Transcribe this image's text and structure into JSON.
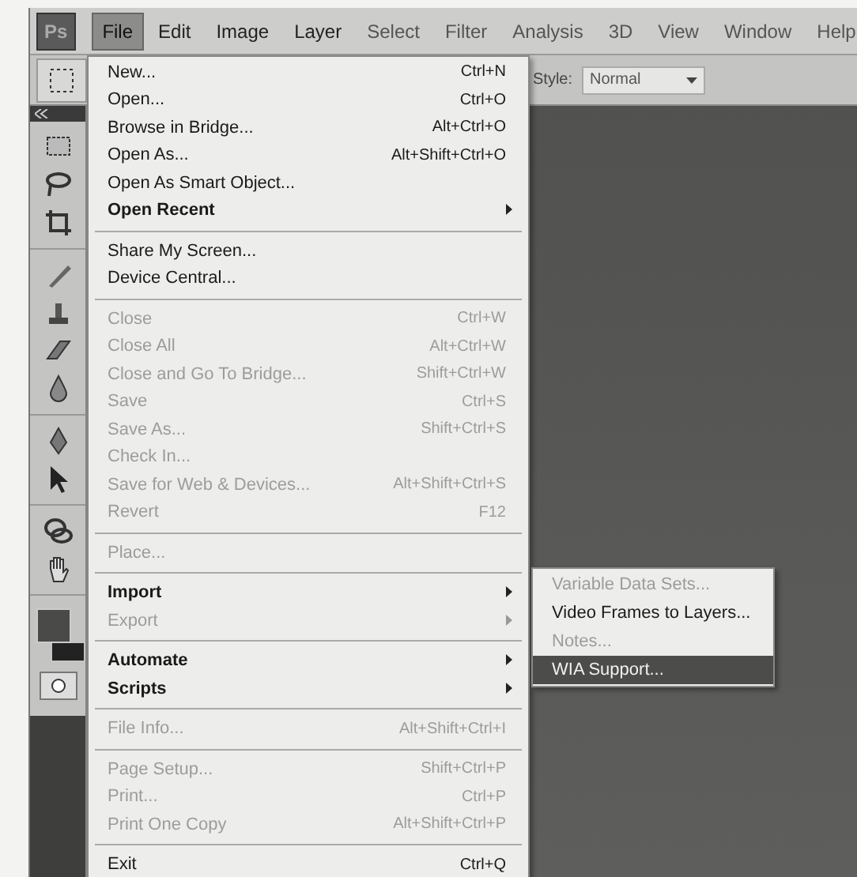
{
  "menubar": {
    "logo": "Ps",
    "items": [
      {
        "label": "File",
        "selected": true
      },
      {
        "label": "Edit",
        "selected": false
      },
      {
        "label": "Image",
        "selected": false
      },
      {
        "label": "Layer",
        "selected": false
      },
      {
        "label": "Select",
        "selected": false
      },
      {
        "label": "Filter",
        "selected": false
      },
      {
        "label": "Analysis",
        "selected": false
      },
      {
        "label": "3D",
        "selected": false
      },
      {
        "label": "View",
        "selected": false
      },
      {
        "label": "Window",
        "selected": false
      },
      {
        "label": "Help",
        "selected": false
      }
    ]
  },
  "options_bar": {
    "style_label": "Style:",
    "style_value": "Normal"
  },
  "file_menu": [
    {
      "kind": "item",
      "label": "New...",
      "shortcut": "Ctrl+N",
      "disabled": false,
      "submenu": false
    },
    {
      "kind": "item",
      "label": "Open...",
      "shortcut": "Ctrl+O",
      "disabled": false,
      "submenu": false
    },
    {
      "kind": "item",
      "label": "Browse in Bridge...",
      "shortcut": "Alt+Ctrl+O",
      "disabled": false,
      "submenu": false
    },
    {
      "kind": "item",
      "label": "Open As...",
      "shortcut": "Alt+Shift+Ctrl+O",
      "disabled": false,
      "submenu": false
    },
    {
      "kind": "item",
      "label": "Open As Smart Object...",
      "disabled": false,
      "submenu": false
    },
    {
      "kind": "item",
      "label": "Open Recent",
      "disabled": false,
      "submenu": true
    },
    {
      "kind": "separator"
    },
    {
      "kind": "item",
      "label": "Share My Screen...",
      "disabled": false,
      "submenu": false
    },
    {
      "kind": "item",
      "label": "Device Central...",
      "disabled": false,
      "submenu": false
    },
    {
      "kind": "separator"
    },
    {
      "kind": "item",
      "label": "Close",
      "shortcut": "Ctrl+W",
      "disabled": true,
      "submenu": false
    },
    {
      "kind": "item",
      "label": "Close All",
      "shortcut": "Alt+Ctrl+W",
      "disabled": true,
      "submenu": false
    },
    {
      "kind": "item",
      "label": "Close and Go To Bridge...",
      "shortcut": "Shift+Ctrl+W",
      "disabled": true,
      "submenu": false
    },
    {
      "kind": "item",
      "label": "Save",
      "shortcut": "Ctrl+S",
      "disabled": true,
      "submenu": false
    },
    {
      "kind": "item",
      "label": "Save As...",
      "shortcut": "Shift+Ctrl+S",
      "disabled": true,
      "submenu": false
    },
    {
      "kind": "item",
      "label": "Check In...",
      "disabled": true,
      "submenu": false
    },
    {
      "kind": "item",
      "label": "Save for Web & Devices...",
      "shortcut": "Alt+Shift+Ctrl+S",
      "disabled": true,
      "submenu": false
    },
    {
      "kind": "item",
      "label": "Revert",
      "shortcut": "F12",
      "disabled": true,
      "submenu": false
    },
    {
      "kind": "separator"
    },
    {
      "kind": "item",
      "label": "Place...",
      "disabled": true,
      "submenu": false
    },
    {
      "kind": "separator"
    },
    {
      "kind": "item",
      "label": "Import",
      "disabled": false,
      "submenu": true
    },
    {
      "kind": "item",
      "label": "Export",
      "disabled": true,
      "submenu": true
    },
    {
      "kind": "separator"
    },
    {
      "kind": "item",
      "label": "Automate",
      "disabled": false,
      "submenu": true
    },
    {
      "kind": "item",
      "label": "Scripts",
      "disabled": false,
      "submenu": true
    },
    {
      "kind": "separator"
    },
    {
      "kind": "item",
      "label": "File Info...",
      "shortcut": "Alt+Shift+Ctrl+I",
      "disabled": true,
      "submenu": false
    },
    {
      "kind": "separator"
    },
    {
      "kind": "item",
      "label": "Page Setup...",
      "shortcut": "Shift+Ctrl+P",
      "disabled": true,
      "submenu": false
    },
    {
      "kind": "item",
      "label": "Print...",
      "shortcut": "Ctrl+P",
      "disabled": true,
      "submenu": false
    },
    {
      "kind": "item",
      "label": "Print One Copy",
      "shortcut": "Alt+Shift+Ctrl+P",
      "disabled": true,
      "submenu": false
    },
    {
      "kind": "separator"
    },
    {
      "kind": "item",
      "label": "Exit",
      "shortcut": "Ctrl+Q",
      "disabled": false,
      "submenu": false
    }
  ],
  "import_submenu": [
    {
      "label": "Variable Data Sets...",
      "disabled": true,
      "selected": false
    },
    {
      "label": "Video Frames to Layers...",
      "disabled": false,
      "selected": false
    },
    {
      "label": "Notes...",
      "disabled": true,
      "selected": false
    },
    {
      "label": "WIA Support...",
      "disabled": false,
      "selected": true
    }
  ]
}
